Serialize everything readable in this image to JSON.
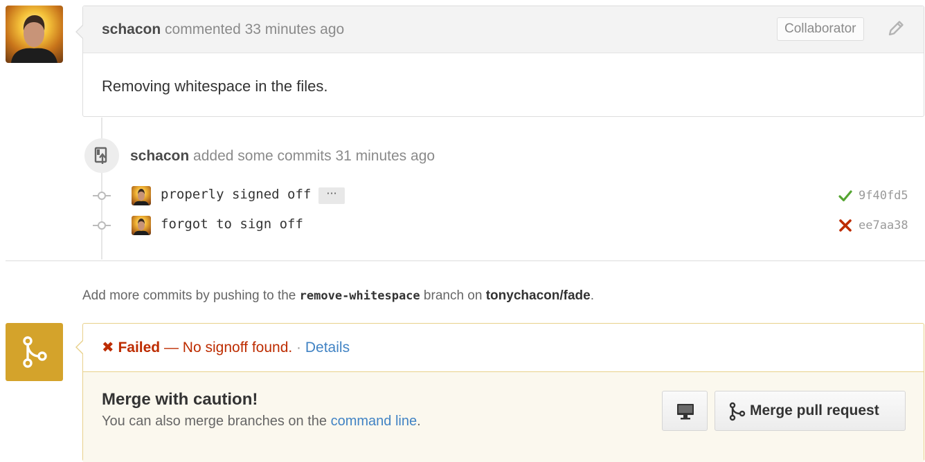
{
  "comment": {
    "author": "schacon",
    "action_text": " commented 33 minutes ago",
    "badge": "Collaborator",
    "body": "Removing whitespace in the files."
  },
  "push_event": {
    "author": "schacon",
    "action_text": " added some commits 31 minutes ago"
  },
  "commits": [
    {
      "message": "properly signed off",
      "has_ellipsis": true,
      "ellipsis": "···",
      "status": "success",
      "status_icon": "check-icon",
      "sha": "9f40fd5"
    },
    {
      "message": "forgot to sign off",
      "has_ellipsis": false,
      "status": "failure",
      "status_icon": "x-icon",
      "sha": "ee7aa38"
    }
  ],
  "push_hint": {
    "prefix": "Add more commits by pushing to the ",
    "branch": "remove-whitespace",
    "middle": " branch on ",
    "repo": "tonychacon/fade",
    "suffix": "."
  },
  "merge": {
    "status_mark": "✖",
    "status_label": " Failed",
    "status_desc": " — No signoff found.",
    "separator": " · ",
    "details_link": "Details",
    "title": "Merge with caution!",
    "subtitle_prefix": "You can also merge branches on the ",
    "subtitle_link": "command line",
    "subtitle_suffix": ".",
    "button_label": "Merge pull request"
  },
  "colors": {
    "success": "#55a532",
    "failure": "#bd2c00",
    "link": "#4183c4",
    "merge_tile": "#d4a32b",
    "merge_border": "#e8d08a"
  },
  "icons": {
    "edit": "pencil-icon",
    "push": "repo-push-icon",
    "merge": "git-merge-icon",
    "desktop": "desktop-monitor-icon"
  }
}
